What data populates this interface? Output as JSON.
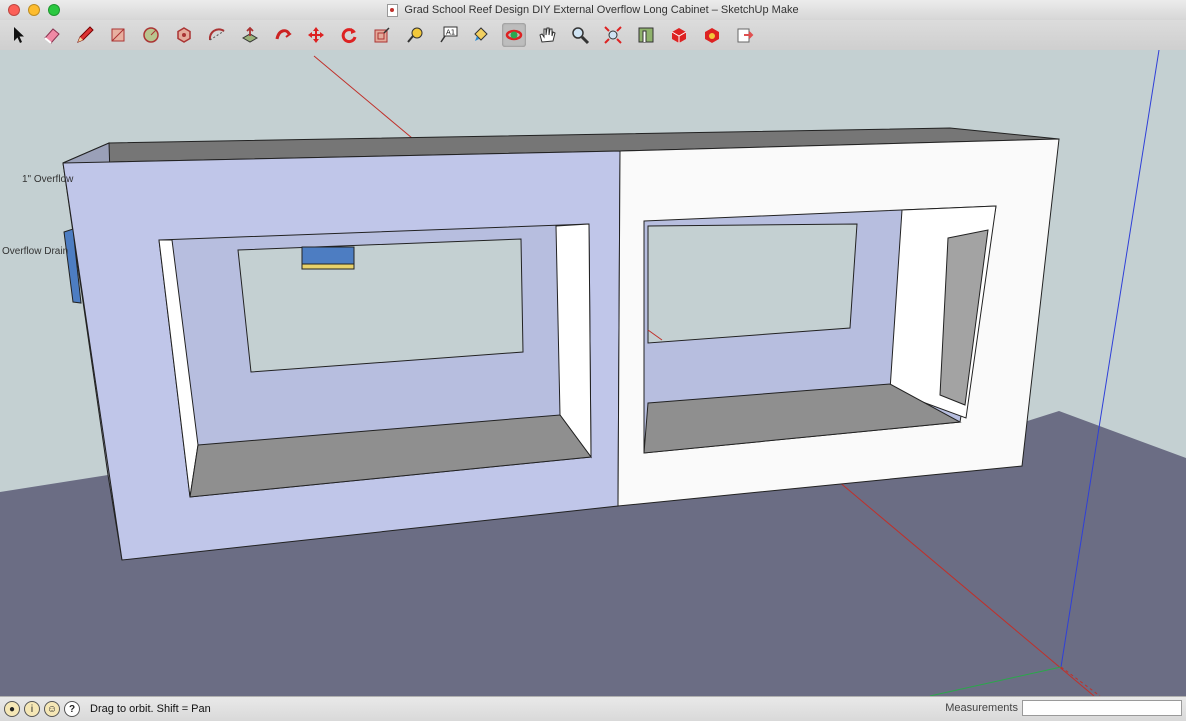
{
  "window": {
    "title": "Grad School Reef Design DIY External Overflow Long Cabinet – SketchUp Make"
  },
  "toolbar": {
    "tools": [
      "select-tool-icon",
      "eraser-tool-icon",
      "pencil-tool-icon",
      "rectangle-tool-icon",
      "circle-tool-icon",
      "polygon-tool-icon",
      "arc-tool-icon",
      "push-pull-tool-icon",
      "follow-me-tool-icon",
      "move-tool-icon",
      "rotate-tool-icon",
      "offset-tool-icon",
      "tape-measure-tool-icon",
      "text-tool-icon",
      "paint-bucket-tool-icon",
      "orbit-tool-icon",
      "pan-tool-icon",
      "zoom-tool-icon",
      "zoom-extents-tool-icon",
      "position-camera-tool-icon",
      "3d-warehouse-icon",
      "extension-warehouse-icon",
      "share-model-icon"
    ],
    "active_tool": "orbit-tool-icon",
    "text_tool_label": "A1"
  },
  "model": {
    "labels": [
      "1\" Overflow",
      "Overflow Drain"
    ]
  },
  "status": {
    "hint": "Drag to orbit.  Shift = Pan",
    "measurements_label": "Measurements",
    "measurements_value": ""
  },
  "colors": {
    "sky": "#c4d0d2",
    "ground": "#6b6d84",
    "selected_face": "#c0c6e9",
    "axis_red": "#c0302a",
    "axis_blue": "#2f3fd8",
    "axis_green": "#2aa84a"
  }
}
